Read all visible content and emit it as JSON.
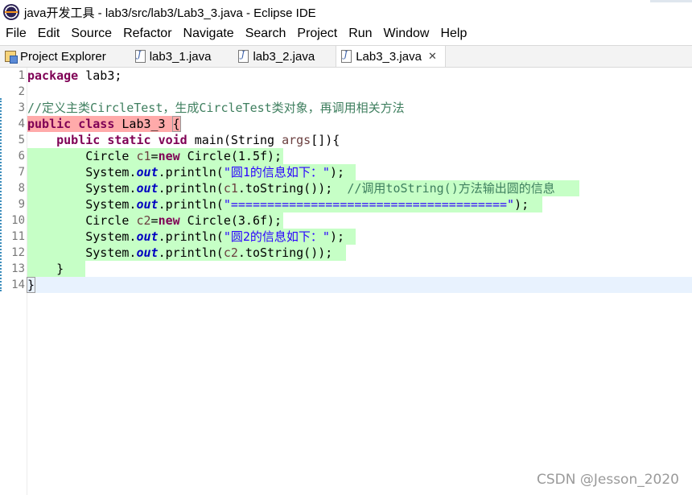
{
  "window": {
    "title": "java开发工具 - lab3/src/lab3/Lab3_3.java - Eclipse IDE"
  },
  "menu": [
    "File",
    "Edit",
    "Source",
    "Refactor",
    "Navigate",
    "Search",
    "Project",
    "Run",
    "Window",
    "Help"
  ],
  "tabs": {
    "explorer": "Project Explorer",
    "files": [
      "lab3_1.java",
      "lab3_2.java",
      "Lab3_3.java"
    ],
    "active_index": 2,
    "close_glyph": "✕"
  },
  "editor": {
    "line_numbers": [
      "1",
      "2",
      "3",
      "4",
      "5",
      "6",
      "7",
      "8",
      "9",
      "10",
      "11",
      "12",
      "13",
      "14"
    ],
    "lines": {
      "l1": {
        "kw": "package",
        "rest": " lab3;"
      },
      "l3": {
        "comment": "//定义主类CircleTest，生成CircleTest类对象，再调用相关方法"
      },
      "l4": {
        "kw1": "public",
        "kw2": "class",
        "name": " Lab3_3 ",
        "brace": "{"
      },
      "l5": {
        "kw1": "public",
        "kw2": "static",
        "kw3": "void",
        "rest": " main(String ",
        "param": "args",
        "rest2": "[]){"
      },
      "l6": {
        "a": "Circle ",
        "var": "c1",
        "b": "=",
        "kw": "new",
        "c": " Circle(1.5f);"
      },
      "l7": {
        "a": "System.",
        "fld": "out",
        "b": ".println(",
        "str": "\"圆1的信息如下：\"",
        "c": ");"
      },
      "l8": {
        "a": "System.",
        "fld": "out",
        "b": ".println(",
        "var": "c1",
        "c": ".toString());  ",
        "comment": "//调用toString()方法输出圆的信息"
      },
      "l9": {
        "a": "System.",
        "fld": "out",
        "b": ".println(",
        "str": "\"======================================\"",
        "c": ");"
      },
      "l10": {
        "a": "Circle ",
        "var": "c2",
        "b": "=",
        "kw": "new",
        "c": " Circle(3.6f);"
      },
      "l11": {
        "a": "System.",
        "fld": "out",
        "b": ".println(",
        "str": "\"圆2的信息如下：\"",
        "c": ");"
      },
      "l12": {
        "a": "System.",
        "fld": "out",
        "b": ".println(",
        "var": "c2",
        "c": ".toString());"
      },
      "l13": {
        "brace": "}"
      },
      "l14": {
        "brace": "}"
      }
    }
  },
  "watermark": "CSDN @Jesson_2020",
  "colors": {
    "keyword": "#7f0055",
    "string": "#2a00ff",
    "comment": "#3f7f5f",
    "field": "#0000c0",
    "added_line": "#c6ffc6",
    "changed_line": "#ffaaaa",
    "current_line": "#e8f2fe"
  }
}
